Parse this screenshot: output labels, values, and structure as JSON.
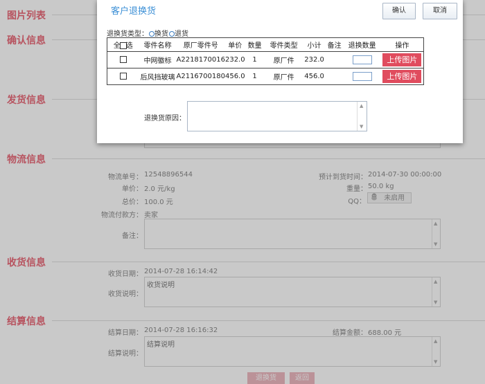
{
  "sections": {
    "image_list": "图片列表",
    "confirm": "确认信息",
    "shipping": "发货信息",
    "logistics": "物流信息",
    "receiving": "收货信息",
    "settlement": "结算信息"
  },
  "logistics": {
    "tracking_label": "物流单号：",
    "tracking_value": "12548896544",
    "unit_price_label": "单价：",
    "unit_price_value": "2.0 元/kg",
    "total_label": "总价：",
    "total_value": "100.0 元",
    "payer_label": "物流付款方：",
    "payer_value": "卖家",
    "notes_label": "备注：",
    "eta_label": "预计到货时间：",
    "eta_value": "2014-07-30 00:00:00",
    "weight_label": "重量：",
    "weight_value": "50.0 kg",
    "qq_label": "QQ：",
    "qq_value": "未启用"
  },
  "receiving": {
    "date_label": "收货日期：",
    "date_value": "2014-07-28 16:14:42",
    "desc_label": "收货说明：",
    "desc_value": "收货说明"
  },
  "settlement": {
    "date_label": "结算日期：",
    "date_value": "2014-07-28 16:16:32",
    "amount_label": "结算金额：",
    "amount_value": "688.00 元",
    "desc_label": "结算说明：",
    "desc_value": "结算说明"
  },
  "bottom_buttons": {
    "return_exchange": "退换货",
    "back": "返回"
  },
  "modal": {
    "title": "客户退换货",
    "confirm_label": "确认",
    "cancel_label": "取消",
    "type_label": "退换货类型：",
    "type_exchange": "换货",
    "type_return": "退货",
    "headers": {
      "select_all": "全选",
      "part_name": "零件名称",
      "oem_no": "原厂零件号",
      "unit_price": "单价",
      "quantity": "数量",
      "part_type": "零件类型",
      "subtotal": "小计",
      "note": "备注",
      "return_qty": "退换数量",
      "action": "操作"
    },
    "rows": [
      {
        "name": "中网徽标",
        "oem": "A2218170016",
        "price": "232.0",
        "qty": "1",
        "type": "原厂件",
        "subtotal": "232.0",
        "note": "",
        "upload": "上传图片"
      },
      {
        "name": "后风挡玻璃",
        "oem": "A2116700180",
        "price": "456.0",
        "qty": "1",
        "type": "原厂件",
        "subtotal": "456.0",
        "note": "",
        "upload": "上传图片"
      }
    ],
    "reason_label": "退换货原因："
  },
  "icons": {
    "qq": "qq-penguin-icon",
    "scroll_up": "scroll-up-arrow-icon",
    "scroll_down": "scroll-down-arrow-icon"
  },
  "colors": {
    "section_title": "#e23b4f",
    "modal_title": "#3b8fd6",
    "upload_button": "#e04c5e",
    "bottom_button": "#e8a3ad"
  }
}
